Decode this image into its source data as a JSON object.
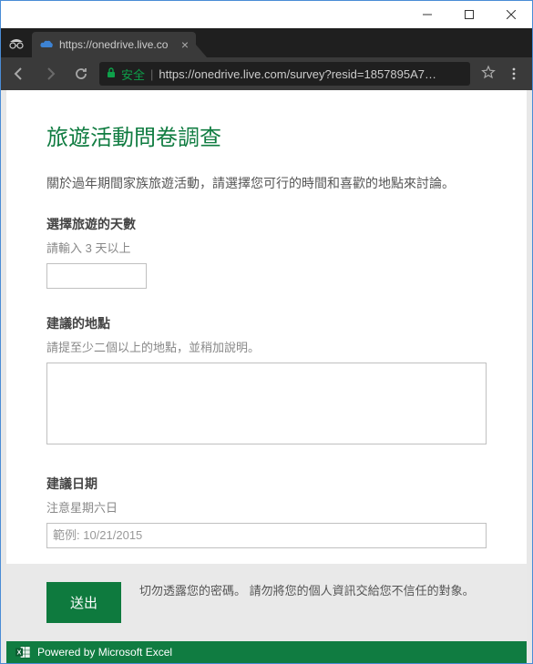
{
  "browser": {
    "tab_title": "https://onedrive.live.co",
    "secure_label": "安全",
    "url_display": "https://onedrive.live.com/survey?resid=1857895A7…"
  },
  "survey": {
    "title": "旅遊活動問卷調查",
    "description": "關於過年期間家族旅遊活動，請選擇您可行的時間和喜歡的地點來討論。",
    "fields": {
      "days": {
        "label": "選擇旅遊的天數",
        "hint": "請輸入 3 天以上"
      },
      "place": {
        "label": "建議的地點",
        "hint": "請提至少二個以上的地點，並稍加說明。"
      },
      "date": {
        "label": "建議日期",
        "hint": "注意星期六日",
        "placeholder": "範例: 10/21/2015"
      }
    },
    "submit_label": "送出",
    "warning_text": "切勿透露您的密碼。 請勿將您的個人資訊交給您不信任的對象。",
    "powered_by": "Powered by Microsoft Excel"
  }
}
